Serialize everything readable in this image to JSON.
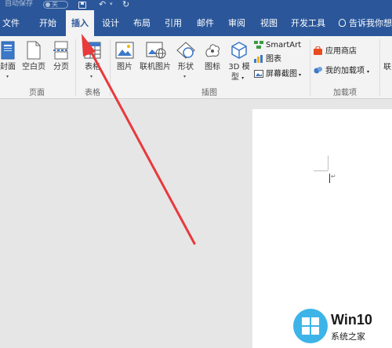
{
  "quick_access": {
    "autosave_label": "自动保存",
    "autosave_state": "关",
    "undo_symbol": "↶",
    "redo_symbol": "↻",
    "dropdown_symbol": "▾"
  },
  "tabs": [
    {
      "label": "文件",
      "active": false
    },
    {
      "label": "开始",
      "active": false
    },
    {
      "label": "插入",
      "active": true
    },
    {
      "label": "设计",
      "active": false
    },
    {
      "label": "布局",
      "active": false
    },
    {
      "label": "引用",
      "active": false
    },
    {
      "label": "邮件",
      "active": false
    },
    {
      "label": "审阅",
      "active": false
    },
    {
      "label": "视图",
      "active": false
    },
    {
      "label": "开发工具",
      "active": false
    }
  ],
  "tell_me": "告诉我你想",
  "ribbon": {
    "pages_group": {
      "label": "页面",
      "cover": "封面",
      "blank_page": "空白页",
      "page_break": "分页"
    },
    "tables_group": {
      "label": "表格",
      "table": "表格"
    },
    "illustrations_group": {
      "label": "插图",
      "pictures": "图片",
      "online_pictures": "联机图片",
      "shapes": "形状",
      "icons": "图标",
      "models_3d_line1": "3D 模",
      "models_3d_line2": "型",
      "smartart": "SmartArt",
      "chart": "图表",
      "screenshot": "屏幕截图"
    },
    "addins_group": {
      "label": "加载项",
      "store": "应用商店",
      "my_addins": "我的加载项"
    },
    "more_initial": "联"
  },
  "document": {
    "paragraph_mark": "↵"
  },
  "watermark": {
    "title": "Win10",
    "subtitle": "系统之家"
  },
  "colors": {
    "brand": "#2b579a",
    "ribbon_bg": "#f3f3f3",
    "canvas_bg": "#e6e6e6",
    "arrow": "#e8393b",
    "store_icon": "#e84c1f",
    "watermark_blue": "#3db4e8"
  }
}
